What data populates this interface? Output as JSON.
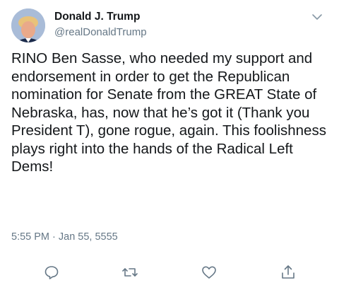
{
  "author": {
    "name": "Donald J. Trump",
    "handle": "@realDonaldTrump"
  },
  "tweet": {
    "text": "RINO Ben Sasse, who needed my support and endorsement in order to get the Republican nomination for Senate from the GREAT State of Nebraska, has, now that he’s got it (Thank you President T), gone rogue, again. This foolishness plays right into the hands of the Radical Left Dems!",
    "timestamp": "5:55 PM · Jan 55, 5555"
  },
  "actions": {
    "reply_icon": "reply-icon",
    "retweet_icon": "retweet-icon",
    "like_icon": "heart-icon",
    "share_icon": "share-icon"
  },
  "colors": {
    "text_primary": "#14171a",
    "text_secondary": "#657786",
    "icon": "#657786"
  }
}
